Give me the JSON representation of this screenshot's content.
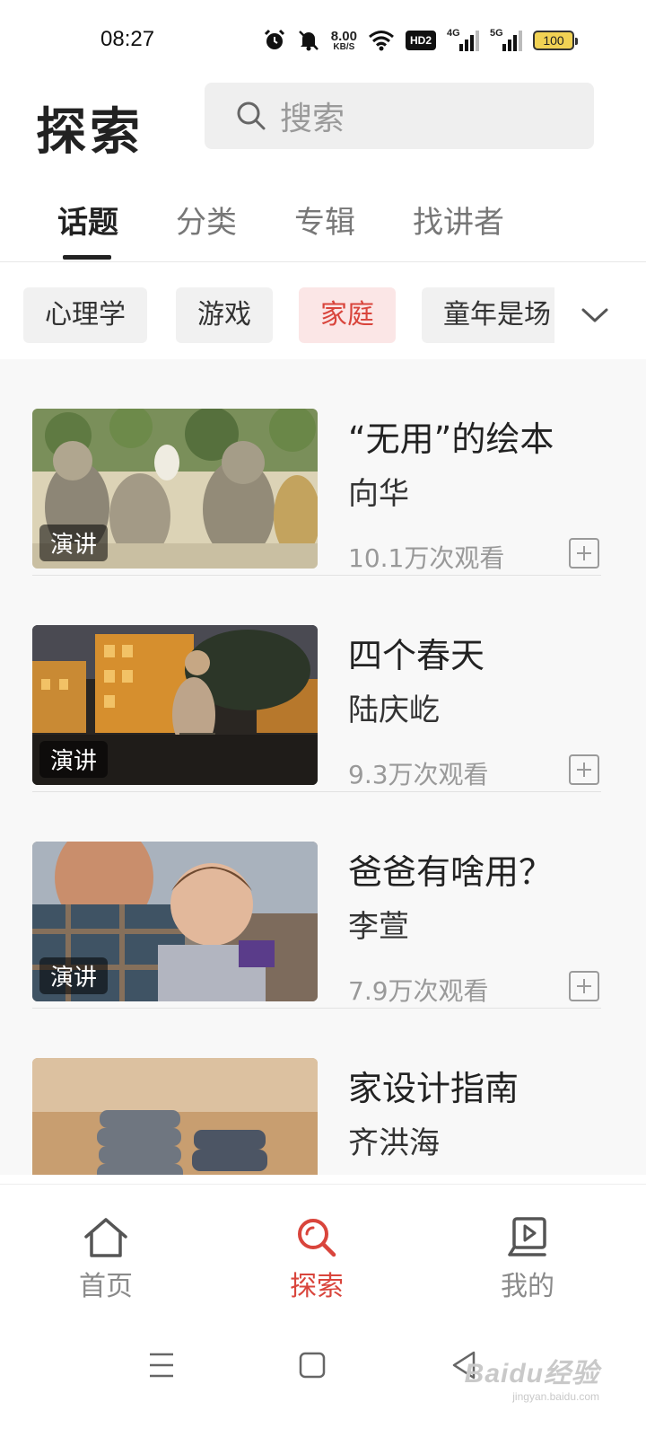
{
  "status_bar": {
    "time": "08:27",
    "net_speed": "8.00",
    "net_speed_unit": "KB/S",
    "hd_label": "HD2",
    "signal_1_label": "4G",
    "signal_2_label": "5G",
    "battery": "100",
    "icons": [
      "alarm-icon",
      "mute-icon",
      "wifi-icon",
      "hd-icon",
      "signal-4g-icon",
      "signal-5g-icon",
      "battery-icon"
    ]
  },
  "header": {
    "title": "探索",
    "search_placeholder": "搜索"
  },
  "tabs": [
    {
      "label": "话题",
      "active": true
    },
    {
      "label": "分类",
      "active": false
    },
    {
      "label": "专辑",
      "active": false
    },
    {
      "label": "找讲者",
      "active": false
    }
  ],
  "chips": [
    {
      "label": "心理学",
      "active": false
    },
    {
      "label": "游戏",
      "active": false
    },
    {
      "label": "家庭",
      "active": true
    },
    {
      "label": "童年是场",
      "active": false
    }
  ],
  "items": [
    {
      "title": "“无用”的绘本",
      "speaker": "向华",
      "views": "10.1万次观看",
      "badge": "演讲"
    },
    {
      "title": "四个春天",
      "speaker": "陆庆屹",
      "views": "9.3万次观看",
      "badge": "演讲"
    },
    {
      "title": "爸爸有啥用？",
      "speaker": "李萱",
      "views": "7.9万次观看",
      "badge": "演讲"
    },
    {
      "title": "家设计指南",
      "speaker": "齐洪海",
      "views": "",
      "badge": ""
    }
  ],
  "bottom_nav": [
    {
      "label": "首页",
      "icon": "home-icon",
      "active": false
    },
    {
      "label": "探索",
      "icon": "search-icon",
      "active": true
    },
    {
      "label": "我的",
      "icon": "my-videos-icon",
      "active": false
    }
  ],
  "watermark": {
    "brand": "Baidu经验",
    "url": "jingyan.baidu.com"
  },
  "colors": {
    "accent": "#d9453c",
    "chip_active_bg": "#fbe6e6",
    "list_bg": "#f8f8f8"
  }
}
